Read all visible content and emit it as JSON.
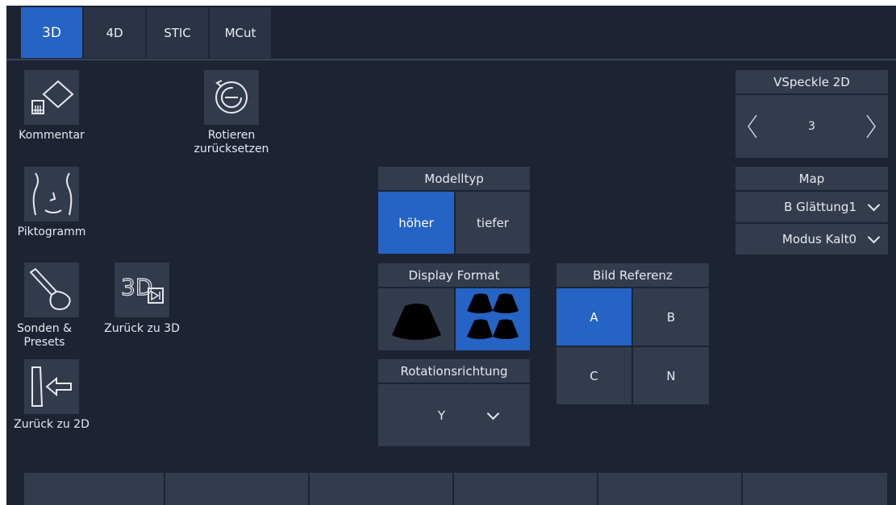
{
  "tabs": [
    {
      "label": "3D",
      "active": true
    },
    {
      "label": "4D",
      "active": false
    },
    {
      "label": "STIC",
      "active": false
    },
    {
      "label": "MCut",
      "active": false
    }
  ],
  "tools": {
    "kommentar": "Kommentar",
    "rotieren_line1": "Rotieren",
    "rotieren_line2": "zurücksetzen",
    "piktogramm": "Piktogramm",
    "sonden_line1": "Sonden &",
    "sonden_line2": "Presets",
    "zurueck_3d": "Zurück zu 3D",
    "zurueck_2d": "Zurück zu 2D"
  },
  "modelltyp": {
    "title": "Modelltyp",
    "options": [
      "höher",
      "tiefer"
    ],
    "selected": "höher"
  },
  "display_format": {
    "title": "Display Format",
    "selected": "quad"
  },
  "rotationsrichtung": {
    "title": "Rotationsrichtung",
    "value": "Y"
  },
  "bild_referenz": {
    "title": "Bild Referenz",
    "options": [
      "A",
      "B",
      "C",
      "N"
    ],
    "selected": "A"
  },
  "vspeckle": {
    "title": "VSpeckle 2D",
    "value": "3"
  },
  "map": {
    "title": "Map",
    "glaettung": "B Glättung1",
    "modus": "Modus Kalt0"
  },
  "colors": {
    "background": "#1c2433",
    "tile": "#323b4b",
    "accent": "#2563c4"
  }
}
